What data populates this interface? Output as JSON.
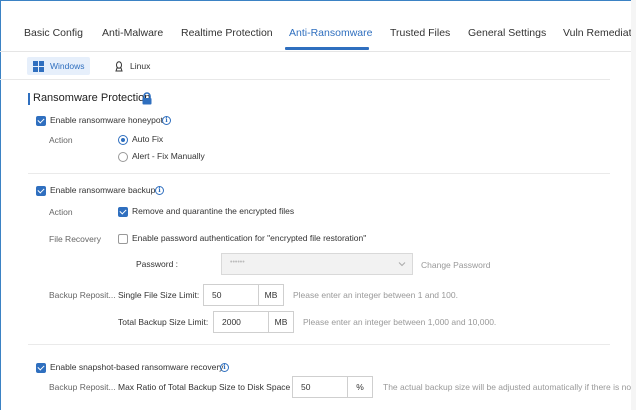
{
  "tabs": [
    {
      "label": "Basic Config"
    },
    {
      "label": "Anti-Malware"
    },
    {
      "label": "Realtime Protection"
    },
    {
      "label": "Anti-Ransomware"
    },
    {
      "label": "Trusted Files"
    },
    {
      "label": "General Settings"
    },
    {
      "label": "Vuln Remediati"
    }
  ],
  "active_tab": "Anti-Ransomware",
  "os": {
    "windows": "Windows",
    "linux": "Linux",
    "selected": "Windows"
  },
  "section": {
    "title": "Ransomware Protection"
  },
  "honeypot": {
    "label": "Enable ransomware honeypot",
    "checked": true,
    "action_label": "Action",
    "options": [
      "Auto Fix",
      "Alert - Fix Manually"
    ],
    "selected": "Auto Fix"
  },
  "backup": {
    "label": "Enable ransomware backup",
    "checked": true,
    "action_label": "Action",
    "action_option": "Remove and quarantine the encrypted files",
    "file_recovery_label": "File Recovery",
    "file_recovery_option": "Enable password authentication for \"encrypted file restoration\"",
    "password_label": "Password :",
    "password_value": "••••••",
    "change_password": "Change Password",
    "backup_repo_label": "Backup Reposit...",
    "single_file_label": "Single File Size Limit:",
    "single_file_value": "50",
    "single_file_unit": "MB",
    "single_file_hint": "Please enter an integer between 1 and 100.",
    "total_label": "Total Backup Size Limit:",
    "total_value": "2000",
    "total_unit": "MB",
    "total_hint": "Please enter an integer between 1,000 and 10,000."
  },
  "snapshot": {
    "label": "Enable snapshot-based ransomware recovery",
    "checked": true,
    "backup_repo_label": "Backup Reposit...",
    "ratio_label": "Max Ratio of Total Backup Size to Disk Space",
    "ratio_value": "50",
    "ratio_unit": "%",
    "ratio_hint": "The actual backup size will be adjusted automatically if there is not e"
  },
  "colors": {
    "accent": "#2f6fbf",
    "border": "#cfcfcf",
    "hint": "#999999"
  }
}
